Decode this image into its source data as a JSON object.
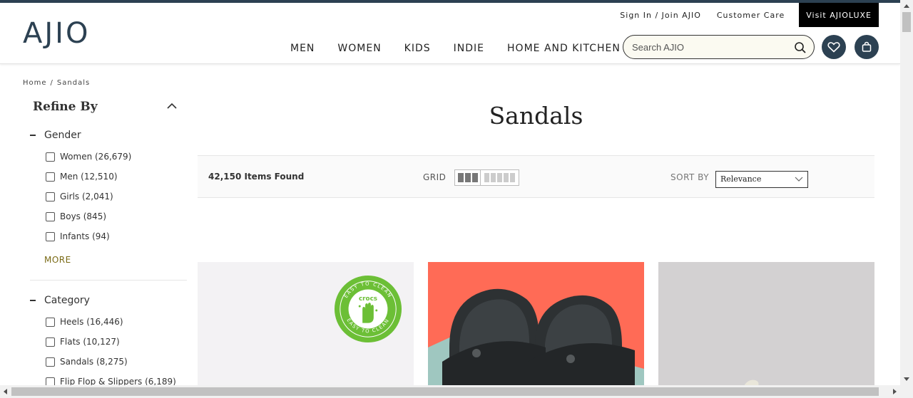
{
  "header": {
    "logo": "AJIO",
    "util_links": [
      "Sign In / Join AJIO",
      "Customer Care"
    ],
    "luxe_link": "Visit AJIOLUXE",
    "nav": [
      "MEN",
      "WOMEN",
      "KIDS",
      "INDIE",
      "HOME AND KITCHEN"
    ],
    "search_placeholder": "Search AJIO"
  },
  "breadcrumb": [
    "Home",
    "Sandals"
  ],
  "sidebar": {
    "title": "Refine By",
    "facets": [
      {
        "name": "Gender",
        "options": [
          "Women (26,679)",
          "Men (12,510)",
          "Girls (2,041)",
          "Boys (845)",
          "Infants (94)"
        ],
        "more_label": "MORE"
      },
      {
        "name": "Category",
        "options": [
          "Heels (16,446)",
          "Flats (10,127)",
          "Sandals (8,275)",
          "Flip Flop & Slippers (6,189)"
        ]
      }
    ]
  },
  "main": {
    "title": "Sandals",
    "items_found": "42,150 Items Found",
    "grid_label": "GRID",
    "sort_label": "SORT BY",
    "sort_value": "Relevance"
  },
  "products": [
    {
      "badge_top": "EASY TO CLEAN",
      "badge_brand": "crocs",
      "badge_word": "CLEAN",
      "badge_bottom": "EASY TO CLEAN"
    },
    {},
    {}
  ],
  "colors": {
    "brand": "#2c4152",
    "badge_green": "#6cbf36",
    "product2_bg": "#ff6b56",
    "more_link": "#7a6a15"
  }
}
